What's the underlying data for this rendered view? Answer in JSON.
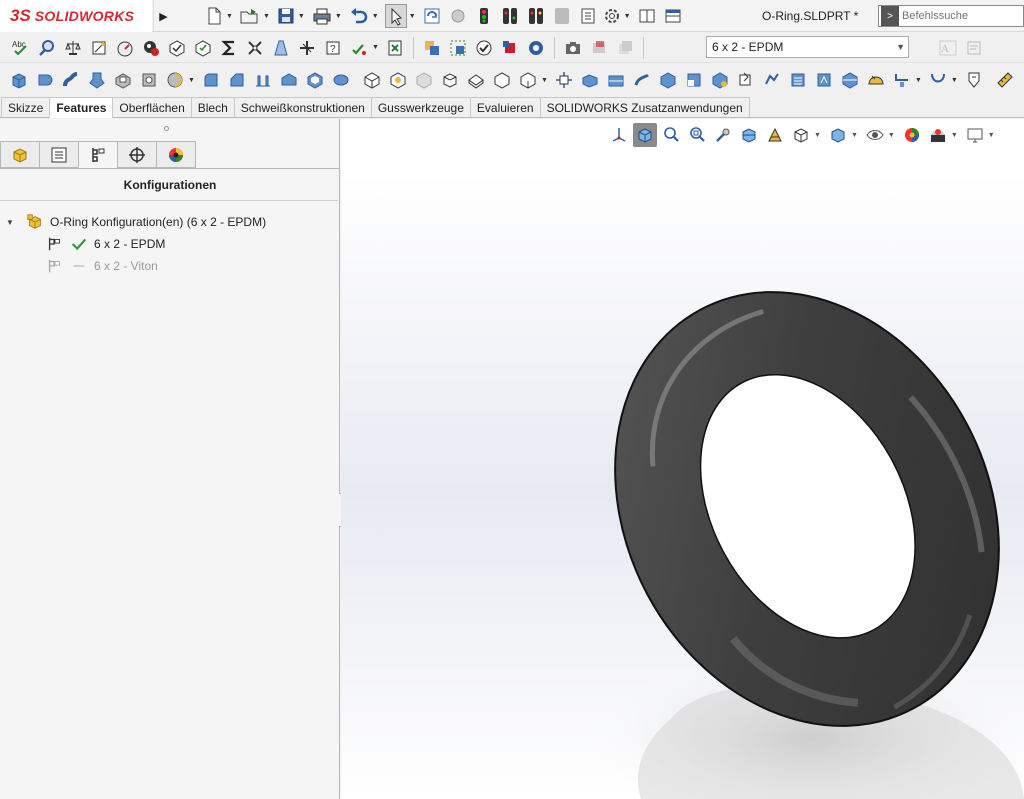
{
  "app": {
    "logo_ds": "3S",
    "logo_text": "SOLIDWORKS",
    "document_title": "O-Ring.SLDPRT *"
  },
  "search": {
    "placeholder": "Befehlssuche"
  },
  "config_select": {
    "value": "6 x 2 - EPDM"
  },
  "tabs": [
    {
      "label": "Skizze",
      "active": false
    },
    {
      "label": "Features",
      "active": true
    },
    {
      "label": "Oberflächen",
      "active": false
    },
    {
      "label": "Blech",
      "active": false
    },
    {
      "label": "Schweißkonstruktionen",
      "active": false
    },
    {
      "label": "Gusswerkzeuge",
      "active": false
    },
    {
      "label": "Evaluieren",
      "active": false
    },
    {
      "label": "SOLIDWORKS Zusatzanwendungen",
      "active": false
    }
  ],
  "panel": {
    "title": "Konfigurationen",
    "root": "O-Ring Konfiguration(en)  (6 x 2 - EPDM)",
    "configs": [
      {
        "label": "6 x 2 - EPDM",
        "active": true
      },
      {
        "label": "6 x 2 - Viton",
        "active": false
      }
    ]
  },
  "colors": {
    "brand_red": "#d8282f",
    "active_check": "#2e9a3a",
    "ring_body": "#4a4a4a"
  }
}
